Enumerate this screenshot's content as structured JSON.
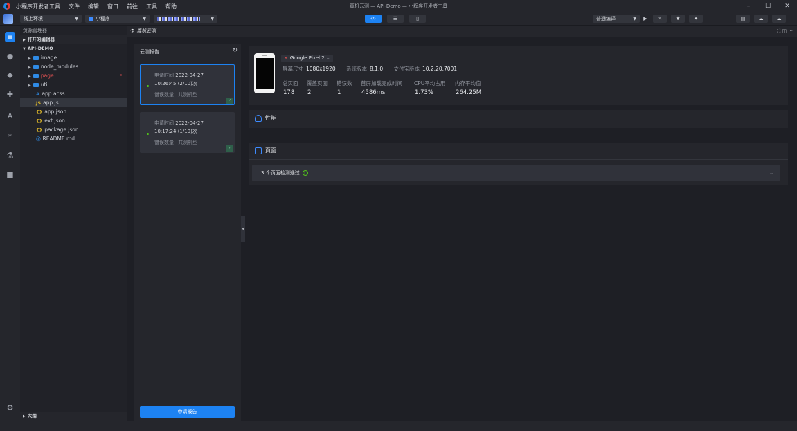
{
  "titlebar": {
    "menu": [
      "小程序开发者工具",
      "文件",
      "编辑",
      "窗口",
      "前往",
      "工具",
      "帮助"
    ],
    "window_title": "真机云测 — API-Demo — 小程序开发者工具",
    "controls": [
      "–",
      "☐",
      "✕"
    ]
  },
  "toolbar": {
    "env": "线上环境",
    "type": "小程序",
    "compile": "普通编译"
  },
  "explorer": {
    "header": "资源管理器",
    "open_editors": "打开的编辑器",
    "project": "API-DEMO",
    "items": [
      {
        "label": "image"
      },
      {
        "label": "node_modules"
      },
      {
        "label": "page"
      },
      {
        "label": "util"
      },
      {
        "label": "app.acss",
        "icon": "#"
      },
      {
        "label": "app.js",
        "icon": "JS"
      },
      {
        "label": "app.json",
        "icon": "{}"
      },
      {
        "label": "ext.json",
        "icon": "{}"
      },
      {
        "label": "package.json",
        "icon": "{}"
      },
      {
        "label": "README.md",
        "icon": "ⓘ"
      }
    ],
    "outline": "大纲"
  },
  "tab": {
    "label": "真机云测"
  },
  "reports": {
    "title": "云测报告",
    "cards": [
      {
        "apply_label": "申请时间",
        "date": "2022-04-27",
        "time": "10:26:45",
        "count": "(2/10)次",
        "errors": "错误数量",
        "models": "共测机型"
      },
      {
        "apply_label": "申请时间",
        "date": "2022-04-27",
        "time": "10:17:24",
        "count": "(1/10)次",
        "errors": "错误数量",
        "models": "共测机型"
      }
    ],
    "apply_button": "申请报告"
  },
  "device": {
    "name": "Google Pixel 2",
    "specs": [
      {
        "k": "屏幕尺寸",
        "v": "1080x1920"
      },
      {
        "k": "系统版本",
        "v": "8.1.0"
      },
      {
        "k": "支付宝版本",
        "v": "10.2.20.7001"
      }
    ],
    "stats": [
      {
        "label": "总页面",
        "value": "178"
      },
      {
        "label": "覆盖页面",
        "value": "2"
      },
      {
        "label": "错误数",
        "value": "1"
      },
      {
        "label": "首屏加载完成时间",
        "value": "4586ms"
      },
      {
        "label": "CPU平均占用",
        "value": "1.73%"
      },
      {
        "label": "内存平均值",
        "value": "264.25M"
      }
    ]
  },
  "performance": {
    "title": "性能"
  },
  "pages": {
    "title": "页面",
    "summary_count": "3",
    "summary_text": "个页面检测通过"
  },
  "colors": {
    "accent": "#1d82f2",
    "success": "#52c41a",
    "error": "#f25555"
  }
}
